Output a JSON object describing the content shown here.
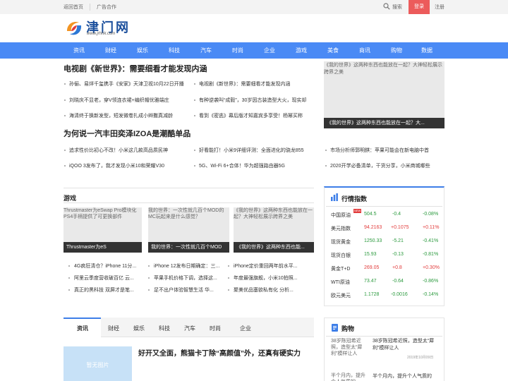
{
  "topbar": {
    "home": "返回首页",
    "ads": "广告合作",
    "search": "搜索",
    "login": "登录",
    "register": "注册"
  },
  "logo": {
    "title": "津门网",
    "url": "www.jrhhk.com"
  },
  "nav": [
    "资讯",
    "财经",
    "娱乐",
    "科技",
    "汽车",
    "时尚",
    "企业",
    "游戏",
    "美食",
    "商讯",
    "购物",
    "数据"
  ],
  "headline1": {
    "title": "电视剧《新世界》：需要细看才能发现内涵",
    "items_left": [
      "孙俪、易烊千玺携手《安家》天津卫视10月22日开播",
      "刘晓庆不显老，穿V领连衣裙+编织帽优雅端庄",
      "海清终于换新发型，短发微卷扎成小辫撒真减龄"
    ],
    "items_right": [
      "电视剧《新世界》：需要细看才能发现内涵",
      "有种逆袭叫“成毅”，30岁因古装造型大火，现实却",
      "看到《密逃》幕后版才知嘉宾多享受！杨幂买称"
    ]
  },
  "headline2": {
    "title": "为何说一汽丰田奕泽IZOA是潮酷单品",
    "items_left": [
      "追求性价比初心不改！小米这几款高品质民神",
      "iQOO 3发布了，我才发现小米10和荣耀V30"
    ],
    "items_right": [
      "好看能打！小米9详细评测：全面进化的骁龙855",
      "5G、Wi-Fi 6+合体！华为超强路由器5G"
    ]
  },
  "feature": {
    "top_alt": "《我的世界》这两种东西也能放在一起？大神轻松展示跨界之美",
    "caption": "《我的世界》这两种东西也能放在一起？大...",
    "items": [
      "市场分析师郭明錤：苹果可能会在新电脑中首",
      "2020开学必备清单，干货分享，小米商城哪些"
    ]
  },
  "games": {
    "title": "游戏",
    "cards": [
      {
        "alt": "Thrustmaster为eSwap Pro模块化PS4手柄提供了可更换部件",
        "caption": "Thrustmaster为eS"
      },
      {
        "alt": "我的世界：一次性就几百个MOD的MC玩起来是什么感觉？",
        "caption": "我的世界：一次性就几百个MOD"
      },
      {
        "alt": "《我的世界》这两种东西也能放在一起？大神轻松展示跨界之美",
        "caption": "《我的世界》这两种东西也能..."
      }
    ],
    "list": [
      [
        "4G疯狂清仓？iPhone 11分...",
        "iPhone 12发布日期确定：三...",
        "iPhone定价重回两年前水平..."
      ],
      [
        "阿里云季度营收破百亿 云...",
        "苹果手机价格下调，选择这...",
        "年度最强旗舰，小米10拍照..."
      ],
      [
        "真正的黑科技 双屏才是笔...",
        "足不出户体验智慧生活 华...",
        "聚美优品塞欲私有化 分析..."
      ]
    ]
  },
  "market": {
    "title": "行情指数",
    "badge": "NEW",
    "rows": [
      {
        "name": "中国原油",
        "value": "504.5",
        "change": "-0.4",
        "pct": "-0.08%",
        "dir": "down"
      },
      {
        "name": "美元指数",
        "value": "94.2163",
        "change": "+0.1075",
        "pct": "+0.11%",
        "dir": "up"
      },
      {
        "name": "现货黄金",
        "value": "1250.33",
        "change": "-5.21",
        "pct": "-0.41%",
        "dir": "down"
      },
      {
        "name": "现货白银",
        "value": "15.93",
        "change": "-0.13",
        "pct": "-0.81%",
        "dir": "down"
      },
      {
        "name": "黄金T+D",
        "value": "269.05",
        "change": "+0.8",
        "pct": "+0.30%",
        "dir": "up"
      },
      {
        "name": "WTI原油",
        "value": "73.47",
        "change": "-0.64",
        "pct": "-0.86%",
        "dir": "down"
      },
      {
        "name": "欧元美元",
        "value": "1.1728",
        "change": "-0.0016",
        "pct": "-0.14%",
        "dir": "down"
      }
    ]
  },
  "tabs": [
    "资讯",
    "财经",
    "娱乐",
    "科技",
    "汽车",
    "时尚",
    "企业"
  ],
  "article": {
    "no_image": "暂无图片",
    "title": "好开又全面，熊猫卡丁除“高颜值”外，还真有硬实力"
  },
  "shopping": {
    "title": "购物",
    "items": [
      {
        "alt": "38岁陈冠希近照，造型太“犀利”模样让人",
        "title": "38岁陈冠希近照，造型太“犀利”模样让人",
        "date": "2019年10月09日"
      },
      {
        "alt": "半个月内，提升个人气质的",
        "title": "半个月内，提升个人气质的",
        "date": ""
      }
    ]
  },
  "colors": {
    "accent": "#4a8af5",
    "login": "#ec5b5b",
    "up": "#e23c3c",
    "down": "#2b9a3e"
  }
}
